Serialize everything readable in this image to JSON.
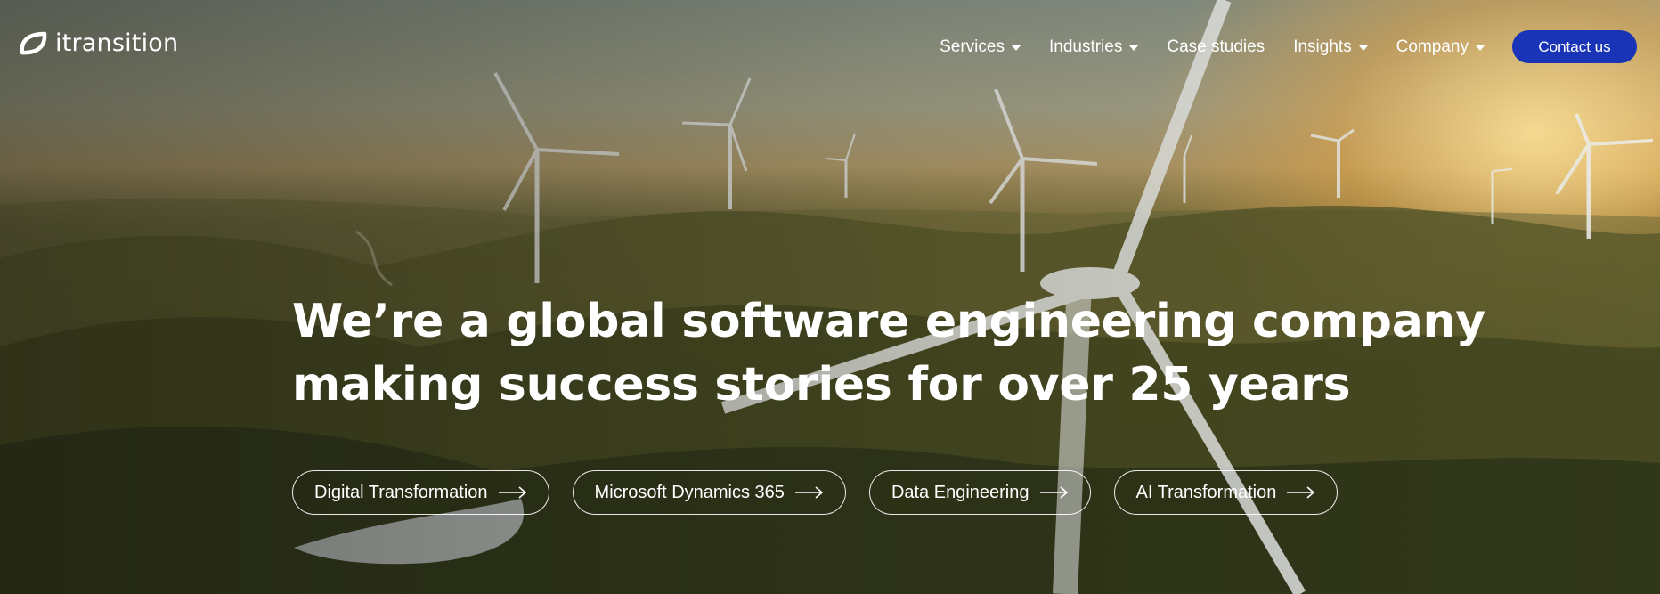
{
  "brand": {
    "name": "itransition"
  },
  "nav": {
    "items": [
      {
        "label": "Services",
        "dropdown": true
      },
      {
        "label": "Industries",
        "dropdown": true
      },
      {
        "label": "Case studies",
        "dropdown": false
      },
      {
        "label": "Insights",
        "dropdown": true
      },
      {
        "label": "Company",
        "dropdown": true
      }
    ],
    "contact_label": "Contact us"
  },
  "hero": {
    "headline_line1": "We’re a global software engineering company",
    "headline_line2": "making success stories for over 25 years",
    "links": [
      {
        "label": "Digital Transformation"
      },
      {
        "label": "Microsoft Dynamics 365"
      },
      {
        "label": "Data Engineering"
      },
      {
        "label": "AI Transformation"
      }
    ]
  },
  "icons": {
    "logo": "leaf-logo-icon",
    "caret": "caret-down-icon",
    "arrow": "arrow-right-icon"
  },
  "colors": {
    "accent": "#1a34b8",
    "text": "#ffffff"
  }
}
